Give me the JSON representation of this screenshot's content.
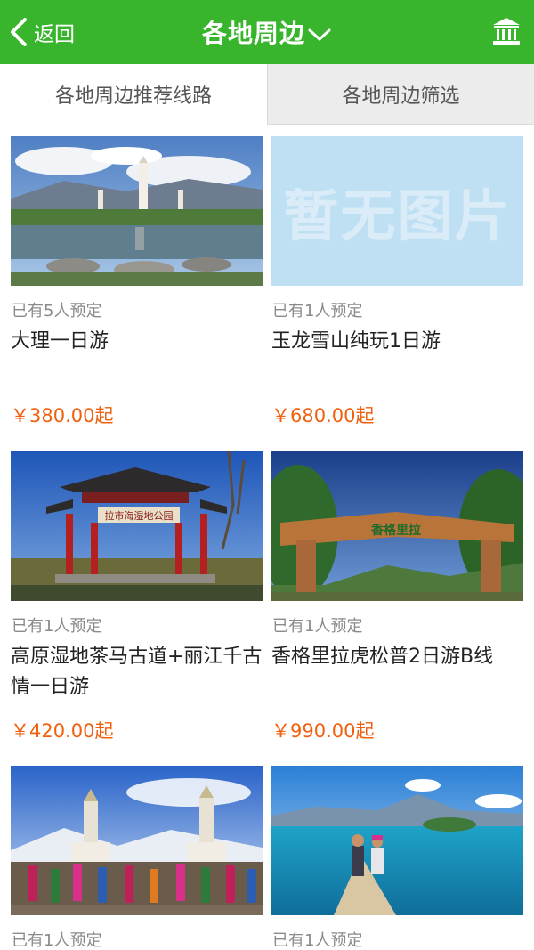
{
  "header": {
    "back_label": "返回",
    "title": "各地周边"
  },
  "tabs": [
    {
      "label": "各地周边推荐线路",
      "active": true
    },
    {
      "label": "各地周边筛选",
      "active": false
    }
  ],
  "products": [
    {
      "booked": "已有5人预定",
      "name": "大理一日游",
      "price": "￥380.00起",
      "image": "dali-three-pagodas"
    },
    {
      "booked": "已有1人预定",
      "name": "玉龙雪山纯玩1日游",
      "price": "￥680.00起",
      "image": "no-image",
      "placeholder_text": "暂无图片"
    },
    {
      "booked": "已有1人预定",
      "name": "高原湿地茶马古道+丽江千古情一日游",
      "price": "￥420.00起",
      "image": "wetland-gate"
    },
    {
      "booked": "已有1人预定",
      "name": "香格里拉虎松普2日游B线",
      "price": "￥990.00起",
      "image": "shangri-la-sign"
    },
    {
      "booked": "已有1人预定",
      "image": "stupa-dancers"
    },
    {
      "booked": "已有1人预定",
      "image": "lugu-lake-boat"
    }
  ],
  "image_captions": {
    "gate_sign": "拉市海湿地公园",
    "shangrila_sign": "香格里拉"
  },
  "colors": {
    "accent": "#38b52c",
    "price": "#f0600e",
    "muted_text": "#8a8a8a"
  }
}
